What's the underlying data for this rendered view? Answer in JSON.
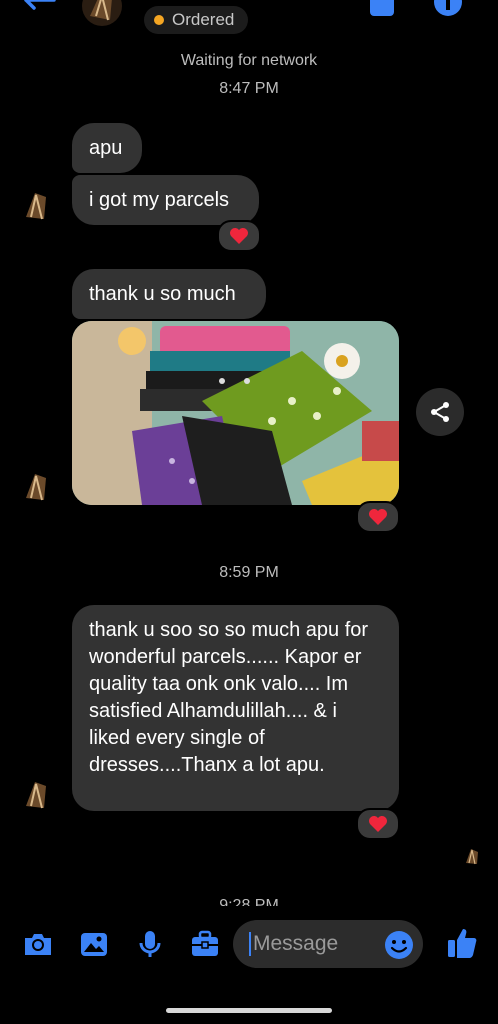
{
  "header": {
    "status_label": "Ordered",
    "status_dot_color": "#f5a623",
    "accent_color": "#3b82f6"
  },
  "network_status": "Waiting for network",
  "timestamps": {
    "first": "8:47 PM",
    "second": "8:59 PM",
    "third_partial": "9:28 PM"
  },
  "messages": {
    "m1": "apu",
    "m2": "i got my parcels",
    "m3": "thank u so much",
    "m5": "thank u soo so so much apu for wonderful parcels...... Kapor er quality taa onk onk valo.... Im satisfied Alhamdulillah.... & i liked every single of dresses....Thanx a lot apu."
  },
  "reaction_icon": "heart-icon",
  "composer": {
    "placeholder": "Message"
  }
}
